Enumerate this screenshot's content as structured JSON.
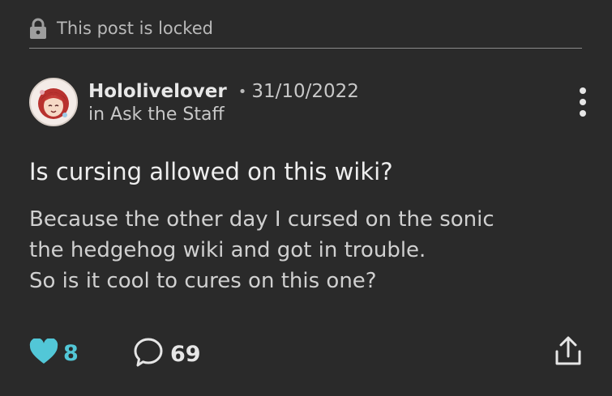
{
  "locked": {
    "icon": "lock-icon",
    "text": "This post is locked"
  },
  "post": {
    "author": "Hololivelover",
    "date": "31/10/2022",
    "category": "in Ask the Staff",
    "title": "Is cursing allowed on this wiki?",
    "body_lines": [
      "Because the other day I cursed on the sonic",
      "the hedgehog wiki and got in trouble.",
      "So is it cool to cures on this one?"
    ]
  },
  "actions": {
    "likes": "8",
    "comments": "69",
    "like_icon": "heart-icon",
    "comment_icon": "comment-bubble-icon",
    "share_icon": "share-icon",
    "more_icon": "more-options-icon"
  },
  "colors": {
    "background": "#2a2a2a",
    "accent": "#52c7d7",
    "text": "#e6e6e6"
  }
}
